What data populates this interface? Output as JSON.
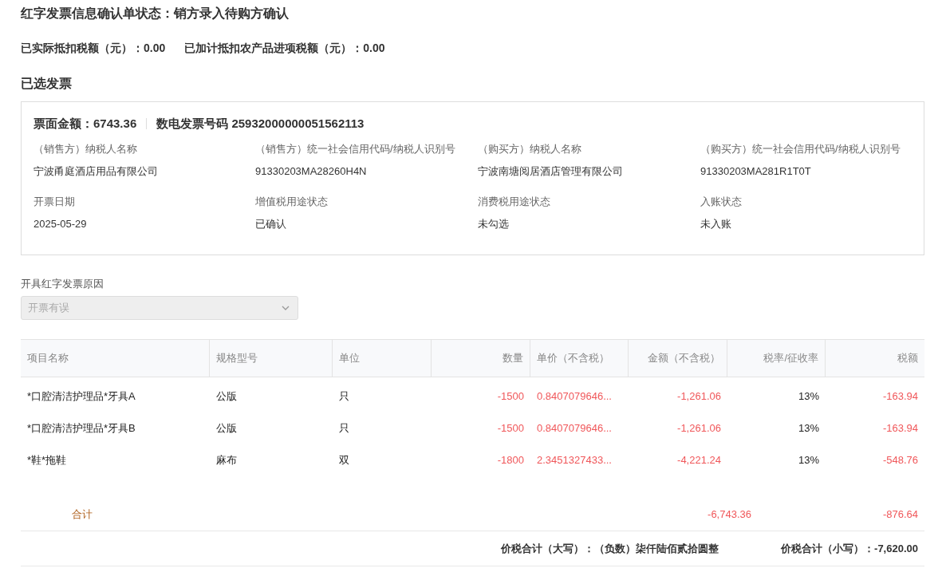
{
  "title": "红字发票信息确认单状态：销方录入待购方确认",
  "deductions": [
    {
      "label": "已实际抵扣税额（元）：",
      "value": "0.00"
    },
    {
      "label": "已加计抵扣农产品进项税额（元）：",
      "value": "0.00"
    }
  ],
  "section_title": "已选发票",
  "invoice": {
    "amount_label": "票面金额：",
    "amount": "6743.36",
    "number_label": "数电发票号码",
    "number": "25932000000051562113",
    "fields": [
      {
        "label": "（销售方）纳税人名称",
        "value": "宁波甬庭酒店用品有限公司"
      },
      {
        "label": "（销售方）统一社会信用代码/纳税人识别号",
        "value": "91330203MA28260H4N"
      },
      {
        "label": "（购买方）纳税人名称",
        "value": "宁波南塘阅居酒店管理有限公司"
      },
      {
        "label": "（购买方）统一社会信用代码/纳税人识别号",
        "value": "91330203MA281R1T0T"
      },
      {
        "label": "开票日期",
        "value": "2025-05-29"
      },
      {
        "label": "增值税用途状态",
        "value": "已确认"
      },
      {
        "label": "消费税用途状态",
        "value": "未勾选"
      },
      {
        "label": "入账状态",
        "value": "未入账"
      }
    ]
  },
  "reason": {
    "label": "开具红字发票原因",
    "value": "开票有误",
    "disabled": true
  },
  "table": {
    "columns": [
      "项目名称",
      "规格型号",
      "单位",
      "数量",
      "单价（不含税）",
      "金额（不含税）",
      "税率/征收率",
      "税额"
    ],
    "rows": [
      [
        "*口腔清洁护理品*牙具A",
        "公版",
        "只",
        "-1500",
        "0.8407079646...",
        "-1,261.06",
        "13%",
        "-163.94"
      ],
      [
        "*口腔清洁护理品*牙具B",
        "公版",
        "只",
        "-1500",
        "0.8407079646...",
        "-1,261.06",
        "13%",
        "-163.94"
      ],
      [
        "*鞋*拖鞋",
        "麻布",
        "双",
        "-1800",
        "2.3451327433...",
        "-4,221.24",
        "13%",
        "-548.76"
      ]
    ],
    "total": {
      "label": "合计",
      "amount": "-6,743.36",
      "tax": "-876.64"
    },
    "summary": [
      {
        "label": "价税合计（大写）：",
        "value": "（负数）柒仟陆佰贰拾圆整"
      },
      {
        "label": "价税合计（小写）：",
        "value": "-7,620.00"
      }
    ]
  }
}
